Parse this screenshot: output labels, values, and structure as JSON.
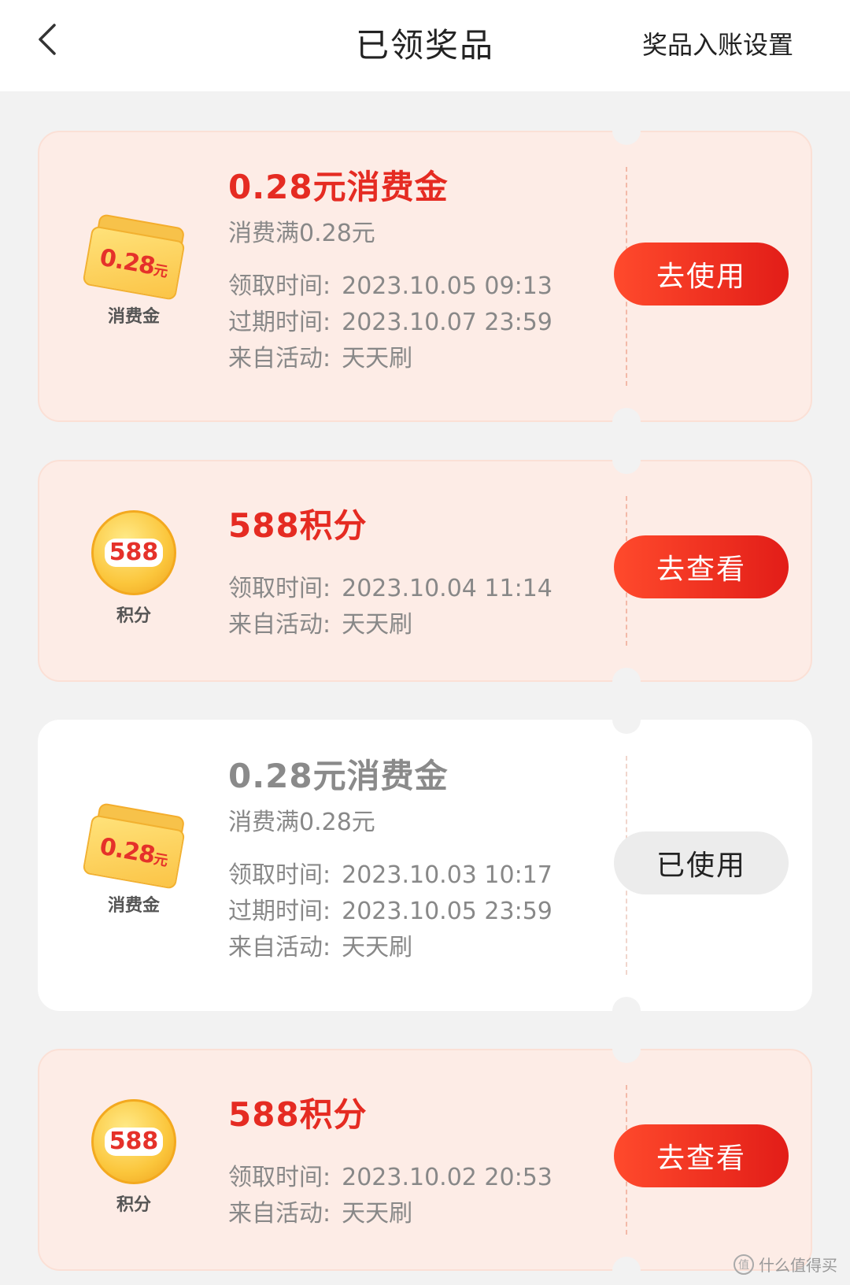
{
  "header": {
    "title": "已领奖品",
    "action": "奖品入账设置"
  },
  "colors": {
    "accent": "#e52b22",
    "card_active_bg": "#fdece6",
    "page_bg": "#f2f2f2"
  },
  "prizes": [
    {
      "icon": "voucher-icon",
      "icon_value": "0.28",
      "icon_unit": "元",
      "icon_caption": "消费金",
      "title": "0.28元消费金",
      "subtitle": "消费满0.28元",
      "received_label": "领取时间:",
      "received_value": "2023.10.05 09:13",
      "expire_label": "过期时间:",
      "expire_value": "2023.10.07 23:59",
      "source_label": "来自活动:",
      "source_value": "天天刷",
      "button": "去使用",
      "status": "active"
    },
    {
      "icon": "coin-icon",
      "icon_value": "588",
      "icon_caption": "积分",
      "title": "588积分",
      "received_label": "领取时间:",
      "received_value": "2023.10.04 11:14",
      "source_label": "来自活动:",
      "source_value": "天天刷",
      "button": "去查看",
      "status": "active"
    },
    {
      "icon": "voucher-icon",
      "icon_value": "0.28",
      "icon_unit": "元",
      "icon_caption": "消费金",
      "title": "0.28元消费金",
      "subtitle": "消费满0.28元",
      "received_label": "领取时间:",
      "received_value": "2023.10.03 10:17",
      "expire_label": "过期时间:",
      "expire_value": "2023.10.05 23:59",
      "source_label": "来自活动:",
      "source_value": "天天刷",
      "button": "已使用",
      "status": "used"
    },
    {
      "icon": "coin-icon",
      "icon_value": "588",
      "icon_caption": "积分",
      "title": "588积分",
      "received_label": "领取时间:",
      "received_value": "2023.10.02 20:53",
      "source_label": "来自活动:",
      "source_value": "天天刷",
      "button": "去查看",
      "status": "active"
    }
  ],
  "watermark": "什么值得买"
}
